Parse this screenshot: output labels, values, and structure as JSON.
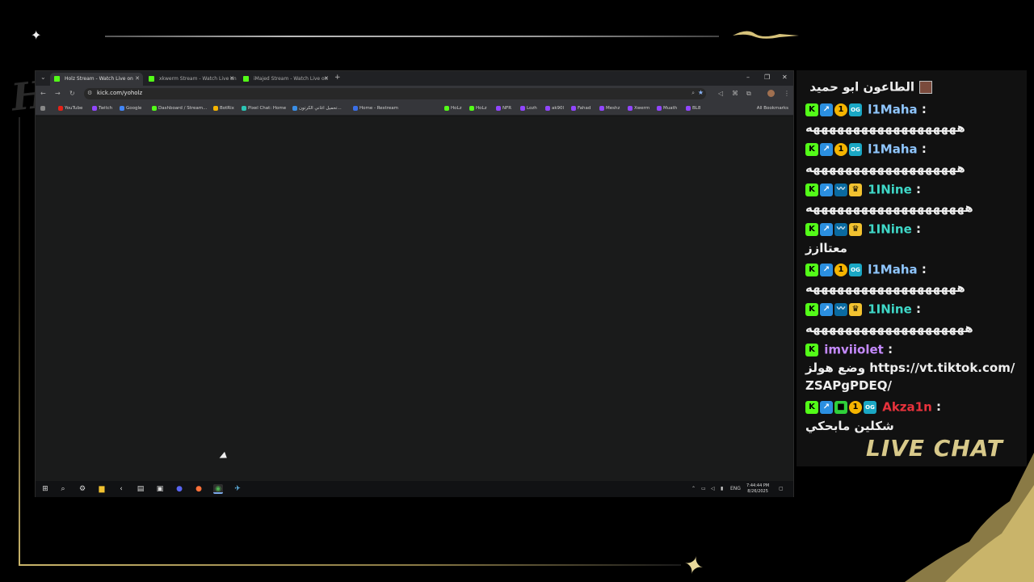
{
  "overlay": {
    "logo_text": "Holz",
    "live_chat_label": "LIVE CHAT"
  },
  "browser": {
    "tabs": [
      {
        "label": "Holz Stream - Watch Live on",
        "active": true
      },
      {
        "label": "xkwerm Stream - Watch Live on",
        "active": false
      },
      {
        "label": "iMajed Stream - Watch Live on",
        "active": false
      }
    ],
    "new_tab_icon": "+",
    "window_controls": [
      "–",
      "❐",
      "✕"
    ],
    "url": "kick.com/yoholz",
    "bookmarks": [
      {
        "label": "YouTube",
        "color": "#e62117"
      },
      {
        "label": "Twitch",
        "color": "#9146ff"
      },
      {
        "label": "Google",
        "color": "#4285f4"
      },
      {
        "label": "Dashboard / Stream...",
        "color": "#53fc18"
      },
      {
        "label": "BotRix",
        "color": "#f5b400"
      },
      {
        "label": "Pixel Chat: Home",
        "color": "#2bc4b4"
      },
      {
        "label": "تحميل اغاني الكرتون...",
        "color": "#3a8ee6"
      },
      {
        "label": "Home - Restream",
        "color": "#3a6ee6"
      },
      {
        "label": "HoLz",
        "color": "#53fc18"
      },
      {
        "label": "HoLz",
        "color": "#53fc18"
      },
      {
        "label": "NFR",
        "color": "#9146ff"
      },
      {
        "label": "Lozh",
        "color": "#9146ff"
      },
      {
        "label": "ak90l",
        "color": "#9146ff"
      },
      {
        "label": "Fahad",
        "color": "#9146ff"
      },
      {
        "label": "Meshz",
        "color": "#9146ff"
      },
      {
        "label": "Xwerm",
        "color": "#9146ff"
      },
      {
        "label": "Muath",
        "color": "#9146ff"
      },
      {
        "label": "BL8",
        "color": "#9146ff"
      }
    ],
    "all_bookmarks": "All Bookmarks",
    "taskbar": {
      "lang": "ENG",
      "time": "7:44:44 PM",
      "date": "8/26/2025"
    }
  },
  "chat": {
    "messages": [
      {
        "user": "الطاعون ابو حميد",
        "user_color": "#eeeeee",
        "badges": [],
        "text": "",
        "avatar": true
      },
      {
        "user": "l1Maha",
        "user_color": "#8fc6ff",
        "badges": [
          "kick",
          "pin",
          "coin",
          "og"
        ],
        "text": "هههههههههههههههههههه"
      },
      {
        "user": "l1Maha",
        "user_color": "#8fc6ff",
        "badges": [
          "kick",
          "pin",
          "coin",
          "og"
        ],
        "text": "هههههههههههههههههههه"
      },
      {
        "user": "1INine",
        "user_color": "#3fd8c8",
        "badges": [
          "kick",
          "pin",
          "sound",
          "crown"
        ],
        "text": "ههههههههههههههههههههه"
      },
      {
        "user": "1INine",
        "user_color": "#3fd8c8",
        "badges": [
          "kick",
          "pin",
          "sound",
          "crown"
        ],
        "text": "معتاازز"
      },
      {
        "user": "l1Maha",
        "user_color": "#8fc6ff",
        "badges": [
          "kick",
          "pin",
          "coin",
          "og"
        ],
        "text": "هههههههههههههههههههه"
      },
      {
        "user": "1INine",
        "user_color": "#3fd8c8",
        "badges": [
          "kick",
          "pin",
          "sound",
          "crown"
        ],
        "text": "ههههههههههههههههههههه"
      },
      {
        "user": "imviiolet",
        "user_color": "#c58aff",
        "badges": [
          "kick"
        ],
        "text": "وضع هولز https://vt.tiktok.com/ZSAPgPDEQ/"
      },
      {
        "user": "Akza1n",
        "user_color": "#e8323c",
        "badges": [
          "kick",
          "pin",
          "cube",
          "coin",
          "og"
        ],
        "text": "شكلين مابحكي"
      }
    ]
  }
}
